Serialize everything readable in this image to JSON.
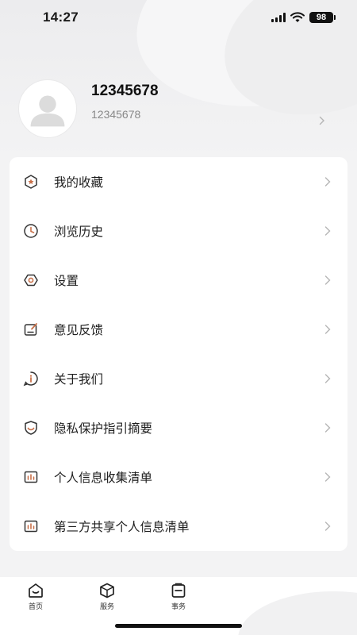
{
  "status": {
    "time": "14:27",
    "battery": "98"
  },
  "profile": {
    "name": "12345678",
    "id": "12345678"
  },
  "menu": {
    "items": [
      {
        "label": "我的收藏",
        "icon": "star-badge-icon"
      },
      {
        "label": "浏览历史",
        "icon": "clock-icon"
      },
      {
        "label": "设置",
        "icon": "gear-icon"
      },
      {
        "label": "意见反馈",
        "icon": "feedback-edit-icon"
      },
      {
        "label": "关于我们",
        "icon": "info-icon"
      },
      {
        "label": "隐私保护指引摘要",
        "icon": "shield-icon"
      },
      {
        "label": "个人信息收集清单",
        "icon": "bar-chart-icon"
      },
      {
        "label": "第三方共享个人信息清单",
        "icon": "bar-chart-icon"
      }
    ]
  },
  "tabbar": {
    "tabs": [
      {
        "label": "首页",
        "icon": "home-icon"
      },
      {
        "label": "服务",
        "icon": "box-icon"
      },
      {
        "label": "事务",
        "icon": "clipboard-icon"
      }
    ]
  },
  "colors": {
    "accent": "#c9714a",
    "icon": "#333333",
    "chevron": "#b5b5b5",
    "card": "#ffffff",
    "background": "#f3f3f4"
  }
}
